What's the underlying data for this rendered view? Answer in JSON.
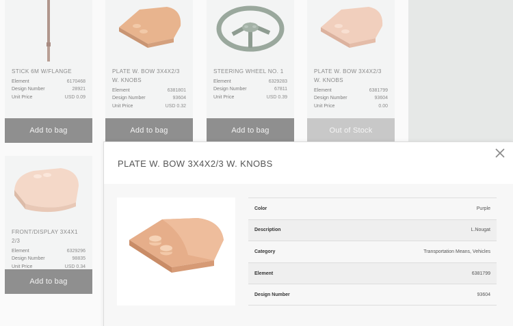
{
  "products": [
    {
      "title_line1": "STICK 6M W/FLANGE",
      "title_line2": "",
      "element_label": "Element",
      "element": "6170468",
      "design_label": "Design Number",
      "design": "28921",
      "price_label": "Unit Price",
      "price": "USD 0.09",
      "button": "Add to bag",
      "icon": "stick-brick-image"
    },
    {
      "title_line1": "PLATE W. BOW 3X4X2/3",
      "title_line2": "W. KNOBS",
      "element_label": "Element",
      "element": "6381801",
      "design_label": "Design Number",
      "design": "93604",
      "price_label": "Unit Price",
      "price": "USD 0.32",
      "button": "Add to bag",
      "icon": "plate-bow-brick-image"
    },
    {
      "title_line1": "STEERING WHEEL NO. 1",
      "title_line2": "",
      "element_label": "Element",
      "element": "6329283",
      "design_label": "Design Number",
      "design": "67811",
      "price_label": "Unit Price",
      "price": "USD 0.39",
      "button": "Add to bag",
      "icon": "steering-wheel-brick-image"
    },
    {
      "title_line1": "PLATE W. BOW 3X4X2/3",
      "title_line2": "W. KNOBS",
      "element_label": "Element",
      "element": "6381799",
      "design_label": "Design Number",
      "design": "93604",
      "price_label": "Unit Price",
      "price": "0.00",
      "button": "Out of Stock",
      "icon": "plate-bow-brick-image"
    },
    {
      "title_line1": "FRONT/DISPLAY 3X4X1 2/3",
      "title_line2": "",
      "element_label": "Element",
      "element": "6329296",
      "design_label": "Design Number",
      "design": "98835",
      "price_label": "Unit Price",
      "price": "USD 0.34",
      "button": "Add to bag",
      "icon": "front-display-brick-image"
    }
  ],
  "modal": {
    "title": "PLATE W. BOW 3X4X2/3 W. KNOBS",
    "close_icon": "close-icon",
    "specs": [
      {
        "label": "Color",
        "value": "Purple"
      },
      {
        "label": "Description",
        "value": "L.Nougat"
      },
      {
        "label": "Category",
        "value": "Transportation Means, Vehicles"
      },
      {
        "label": "Element",
        "value": "6381799"
      },
      {
        "label": "Design Number",
        "value": "93604"
      }
    ]
  },
  "colors": {
    "button_active": "#8f8f8f",
    "button_disabled": "#c8c8c8",
    "brick_nougat": "#e8b899",
    "brick_light": "#f0d0bf",
    "wheel_green": "#9aa89d"
  }
}
